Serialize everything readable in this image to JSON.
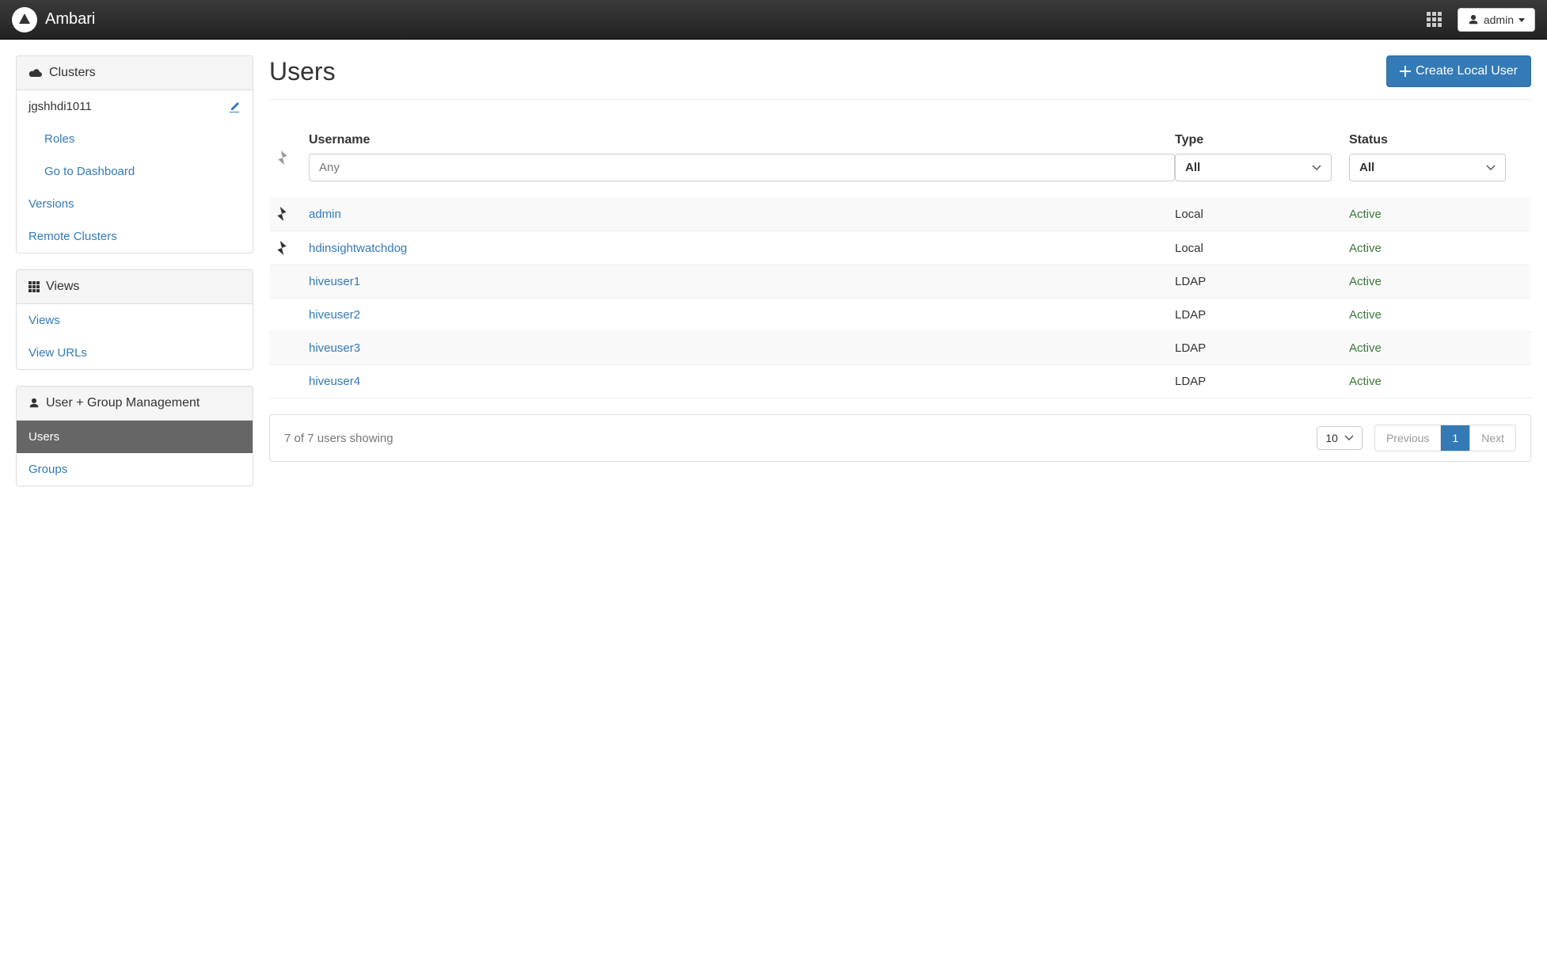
{
  "navbar": {
    "brand": "Ambari",
    "admin_label": "admin"
  },
  "sidebar": {
    "clusters": {
      "heading": "Clusters",
      "cluster_name": "jgshhdi1011",
      "roles": "Roles",
      "dashboard": "Go to Dashboard",
      "versions": "Versions",
      "remote": "Remote Clusters"
    },
    "views": {
      "heading": "Views",
      "views": "Views",
      "urls": "View URLs"
    },
    "user_group": {
      "heading": "User + Group Management",
      "users": "Users",
      "groups": "Groups"
    }
  },
  "main": {
    "title": "Users",
    "create_button": "Create Local User",
    "columns": {
      "username": "Username",
      "type": "Type",
      "status": "Status"
    },
    "filters": {
      "username_placeholder": "Any",
      "type_value": "All",
      "status_value": "All"
    },
    "rows": [
      {
        "admin_icon": true,
        "username": "admin",
        "type": "Local",
        "status": "Active"
      },
      {
        "admin_icon": true,
        "username": "hdinsightwatchdog",
        "type": "Local",
        "status": "Active"
      },
      {
        "admin_icon": false,
        "username": "hiveuser1",
        "type": "LDAP",
        "status": "Active"
      },
      {
        "admin_icon": false,
        "username": "hiveuser2",
        "type": "LDAP",
        "status": "Active"
      },
      {
        "admin_icon": false,
        "username": "hiveuser3",
        "type": "LDAP",
        "status": "Active"
      },
      {
        "admin_icon": false,
        "username": "hiveuser4",
        "type": "LDAP",
        "status": "Active"
      }
    ],
    "pagination": {
      "showing": "7 of 7 users showing",
      "page_size": "10",
      "prev": "Previous",
      "current": "1",
      "next": "Next"
    }
  }
}
